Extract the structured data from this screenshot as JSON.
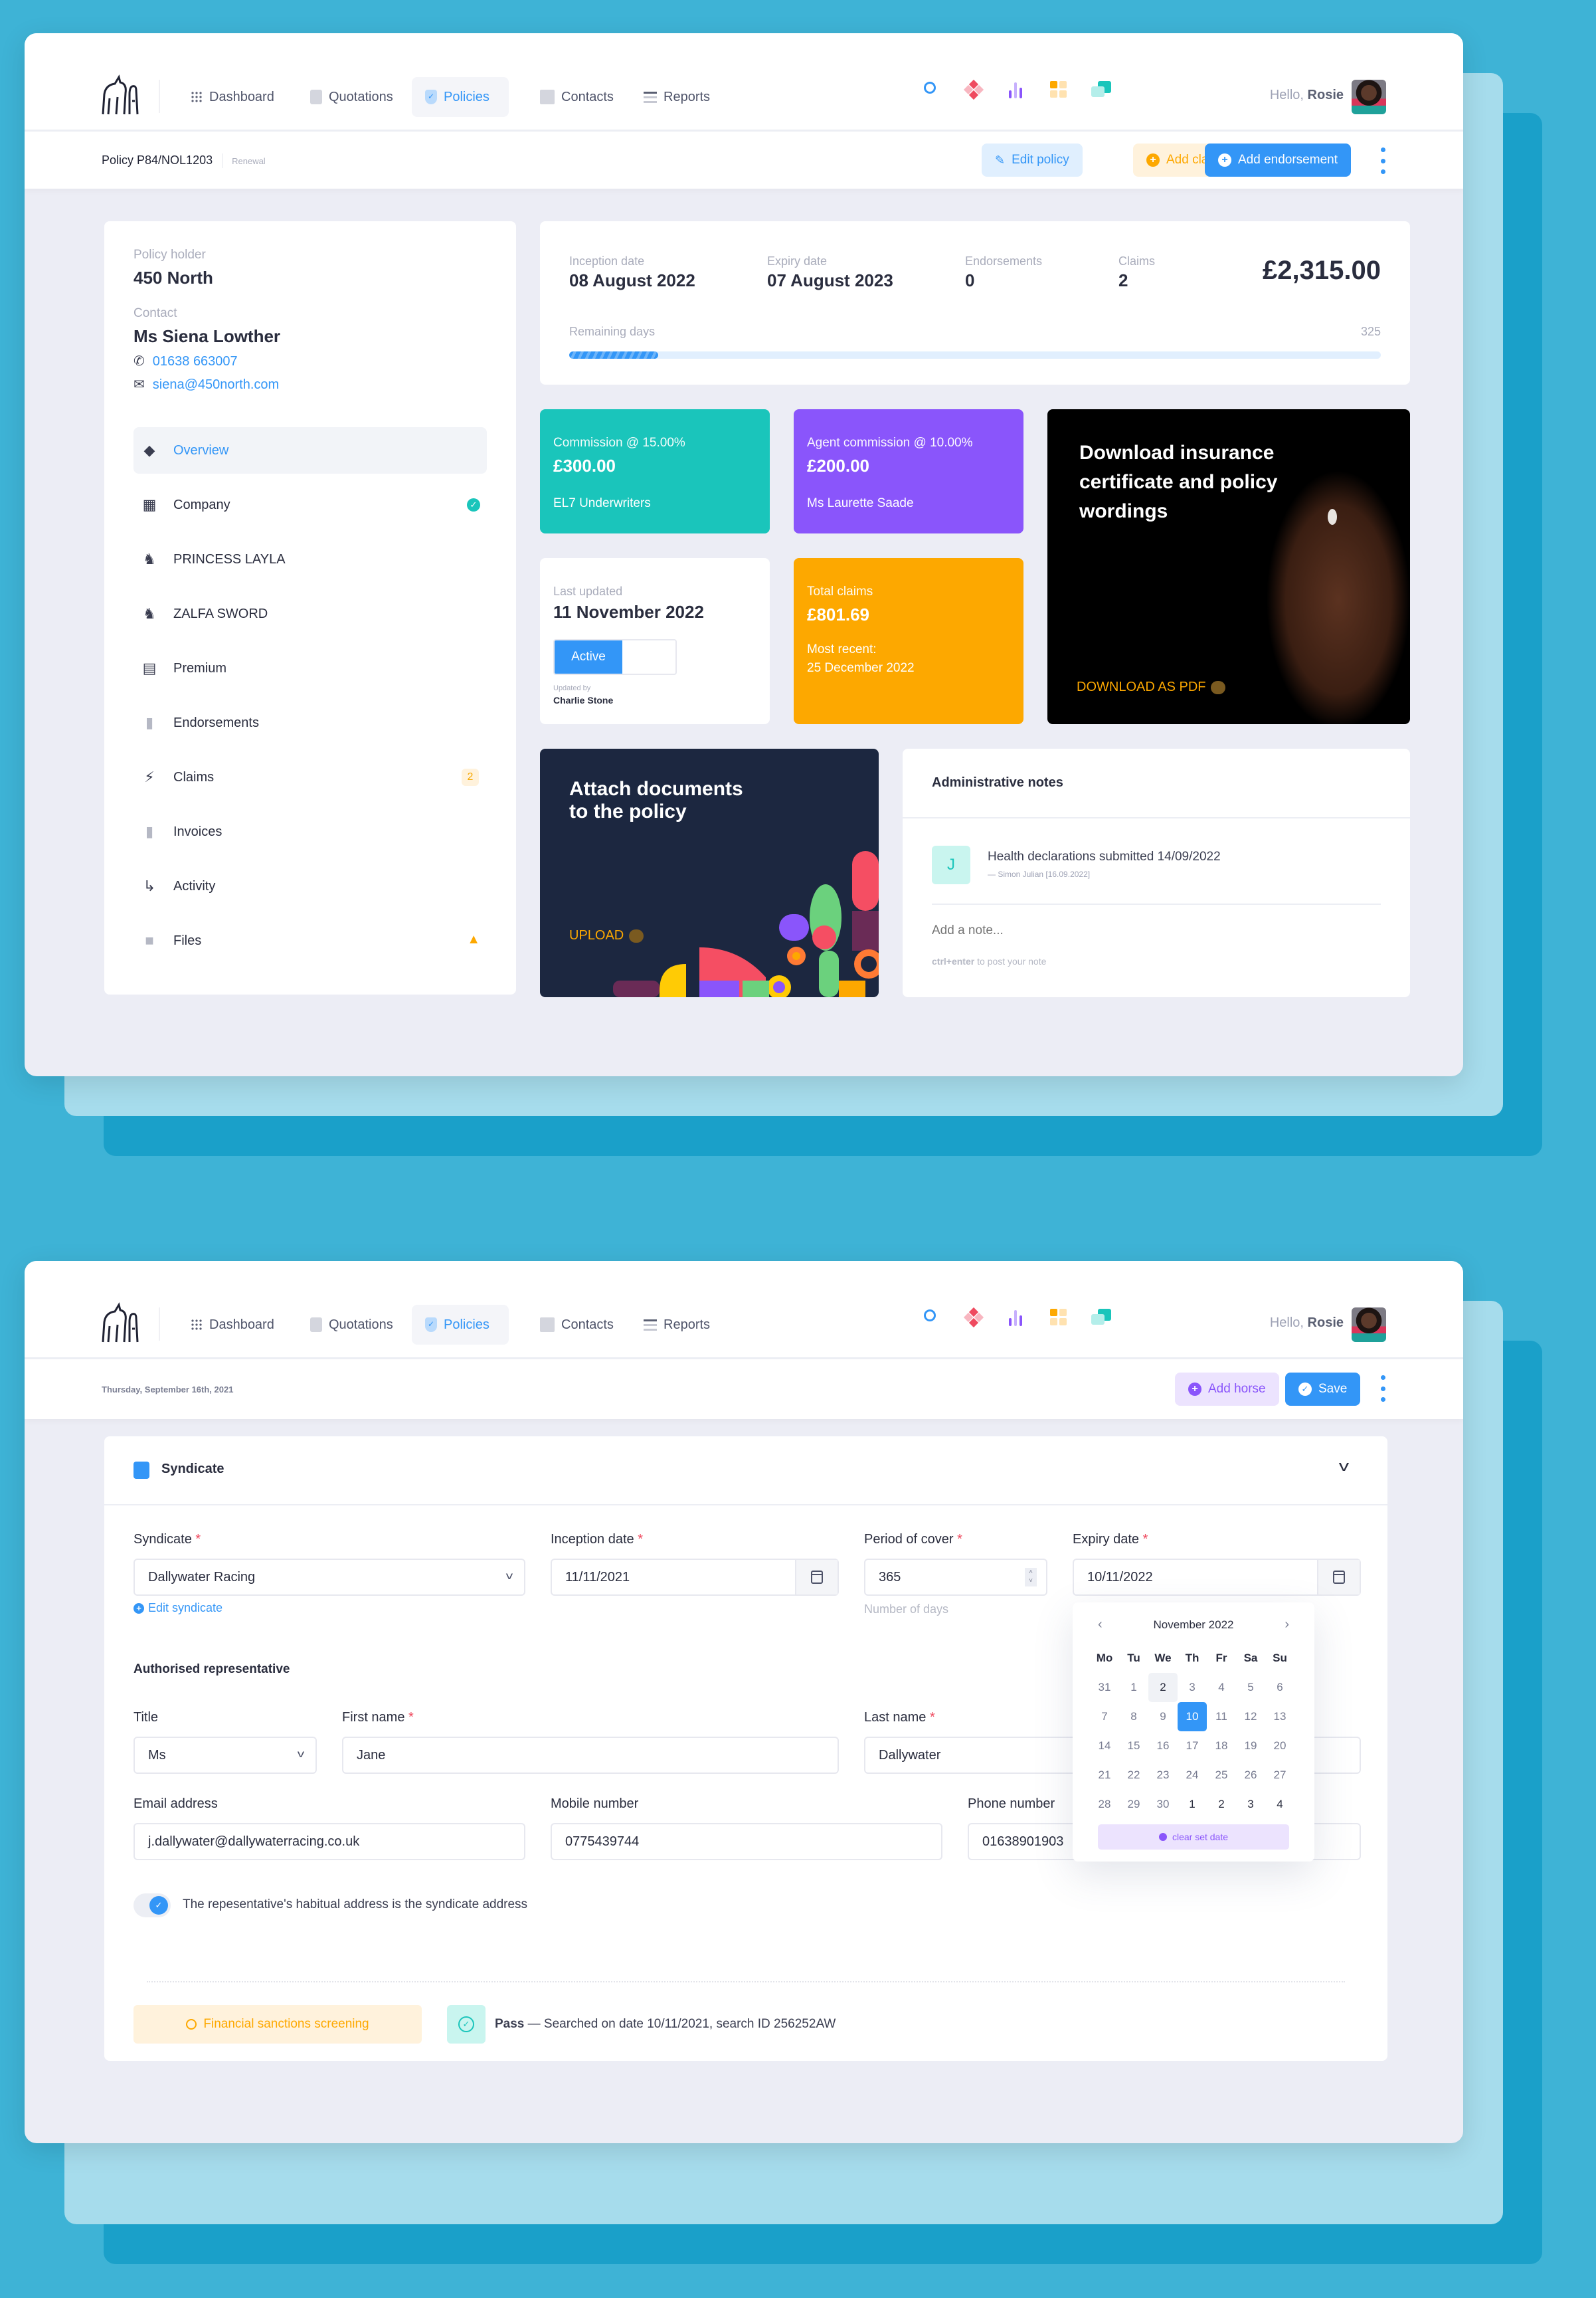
{
  "nav": {
    "items": [
      {
        "label": "Dashboard",
        "icon": "grid-icon"
      },
      {
        "label": "Quotations",
        "icon": "clipboard-icon"
      },
      {
        "label": "Policies",
        "icon": "shield-check-icon",
        "active": true
      },
      {
        "label": "Contacts",
        "icon": "contacts-folder-icon"
      },
      {
        "label": "Reports",
        "icon": "list-icon"
      }
    ],
    "header_icons": [
      "search-icon",
      "diamonds-icon",
      "bar-chart-icon",
      "tiles-icon",
      "chat-icon"
    ],
    "greeting": "Hello,",
    "user_name": "Rosie"
  },
  "screen1": {
    "breadcrumb": {
      "title": "Policy P84/NOL1203",
      "sub": "Renewal"
    },
    "actions": {
      "edit": "Edit policy",
      "claim": "Add claim",
      "endorsement": "Add endorsement"
    },
    "holder": {
      "holder_label": "Policy holder",
      "holder_name": "450 North",
      "contact_label": "Contact",
      "contact_name": "Ms Siena Lowther",
      "phone": "01638 663007",
      "email": "siena@450north.com"
    },
    "sidebar": [
      {
        "label": "Overview",
        "icon": "layers-icon",
        "active": true
      },
      {
        "label": "Company",
        "icon": "building-icon",
        "status": "check"
      },
      {
        "label": "PRINCESS LAYLA",
        "icon": "horse-icon"
      },
      {
        "label": "ZALFA SWORD",
        "icon": "horse-icon"
      },
      {
        "label": "Premium",
        "icon": "calculator-icon"
      },
      {
        "label": "Endorsements",
        "icon": "file-download-icon"
      },
      {
        "label": "Claims",
        "icon": "lightning-icon",
        "badge": "2"
      },
      {
        "label": "Invoices",
        "icon": "file-text-icon"
      },
      {
        "label": "Activity",
        "icon": "arrows-icon"
      },
      {
        "label": "Files",
        "icon": "folder-icon",
        "status": "warning"
      }
    ],
    "summary": {
      "inception_label": "Inception date",
      "inception": "08 August 2022",
      "expiry_label": "Expiry date",
      "expiry": "07 August 2023",
      "endorsements_label": "Endorsements",
      "endorsements": "0",
      "claims_label": "Claims",
      "claims": "2",
      "total": "£2,315.00",
      "remaining_label": "Remaining days",
      "remaining_value": "325",
      "elapsed_fraction": 0.11
    },
    "commission": {
      "label": "Commission @ 15.00%",
      "value": "£300.00",
      "sub": "EL7 Underwriters",
      "color": "#1ac5bb"
    },
    "agent": {
      "label": "Agent commission @ 10.00%",
      "value": "£200.00",
      "sub": "Ms Laurette Saade",
      "color": "#8a55fb"
    },
    "download": {
      "title": "Download insurance certificate and policy wordings",
      "cta": "DOWNLOAD AS PDF"
    },
    "updated": {
      "label": "Last updated",
      "value": "11 November 2022",
      "status": "Active",
      "by_label": "Updated by",
      "by": "Charlie Stone"
    },
    "claims_tile": {
      "label": "Total claims",
      "value": "£801.69",
      "recent_label": "Most recent:",
      "recent": "25 December 2022",
      "color": "#fda800"
    },
    "attach": {
      "title_l1": "Attach documents",
      "title_l2": "to the policy",
      "cta": "UPLOAD"
    },
    "notes": {
      "title": "Administrative notes",
      "items": [
        {
          "initial": "J",
          "text": "Health declarations submitted 14/09/2022",
          "meta": "— Simon Julian [16.09.2022]"
        }
      ],
      "placeholder": "Add a note...",
      "hint_key": "ctrl+enter",
      "hint_rest": " to post your note"
    }
  },
  "screen2": {
    "date": "Thursday, September 16th, 2021",
    "actions": {
      "add_horse": "Add horse",
      "save": "Save"
    },
    "section_title": "Syndicate",
    "fields": {
      "syndicate": {
        "label": "Syndicate",
        "value": "Dallywater Racing",
        "link": "Edit syndicate"
      },
      "inception": {
        "label": "Inception date",
        "value": "11/11/2021"
      },
      "period": {
        "label": "Period of cover",
        "value": "365",
        "hint": "Number of days"
      },
      "expiry": {
        "label": "Expiry date",
        "value": "10/11/2022"
      },
      "rep_heading": "Authorised representative",
      "title": {
        "label": "Title",
        "value": "Ms"
      },
      "first": {
        "label": "First name",
        "value": "Jane"
      },
      "last": {
        "label": "Last name",
        "value": "Dallywater"
      },
      "email": {
        "label": "Email address",
        "value": "j.dallywater@dallywaterracing.co.uk"
      },
      "mobile": {
        "label": "Mobile number",
        "value": "0775439744"
      },
      "phone": {
        "label": "Phone number",
        "value": "01638901903"
      },
      "toggle_label": "The repesentative's habitual address is the syndicate address",
      "toggle_on": true
    },
    "datepicker": {
      "month": "November 2022",
      "weekdays": [
        "Mo",
        "Tu",
        "We",
        "Th",
        "Fr",
        "Sa",
        "Su"
      ],
      "days": [
        "31",
        "1",
        "2",
        "3",
        "4",
        "5",
        "6",
        "7",
        "8",
        "9",
        "10",
        "11",
        "12",
        "13",
        "14",
        "15",
        "16",
        "17",
        "18",
        "19",
        "20",
        "21",
        "22",
        "23",
        "24",
        "25",
        "26",
        "27",
        "28",
        "29",
        "30",
        "1",
        "2",
        "3",
        "4"
      ],
      "today": "2",
      "selected": "10",
      "clear": "clear set date"
    },
    "sanctions": {
      "button": "Financial sanctions screening",
      "result_strong": "Pass",
      "result": " — Searched on date 10/11/2021, search ID 256252AW"
    }
  }
}
